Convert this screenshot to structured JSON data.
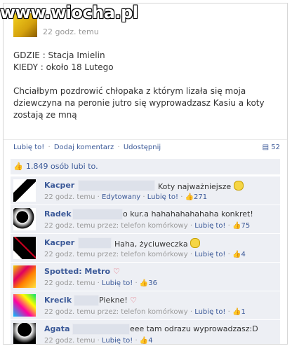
{
  "watermark": {
    "text": "www.wiocha.pl"
  },
  "post": {
    "time": "22 godz. temu",
    "lines": [
      "GDZIE : Stacja Imielin",
      "KIEDY : około 18 Lutego",
      "",
      "Chciałbym pozdrowić chłopaka z którym lizała się moja",
      "dziewczyna na peronie jutro się wyprowadzasz Kasiu a koty",
      "zostają ze mną"
    ]
  },
  "actions": {
    "like": "Lubię to!",
    "comment": "Dodaj komentarz",
    "share": "Udostępnij",
    "share_count": "52"
  },
  "likes": {
    "text": "1.849 osób lubi to."
  },
  "comments": [
    {
      "name": "Kacper",
      "text": "Koty najważniejsze",
      "emoji": "smile",
      "meta_time": "22 godz. temu",
      "meta_extra": "Edytowany",
      "meta_like": "Lubię to!",
      "likes": "271"
    },
    {
      "name": "Radek",
      "text": "o kur.a hahahahahahaha konkret!",
      "emoji": "",
      "meta_time": "22 godz. temu przez: telefon komórkowy",
      "meta_extra": "",
      "meta_like": "Lubię to!",
      "likes": "75"
    },
    {
      "name": "Kacper",
      "text": "Haha, życiuweczka",
      "emoji": "smile",
      "meta_time": "22 godz. temu przez: telefon komórkowy",
      "meta_extra": "",
      "meta_like": "Lubię to!",
      "likes": "4"
    },
    {
      "name": "Spotted: Metro",
      "text": "",
      "emoji": "heart",
      "meta_time": "22 godz. temu",
      "meta_extra": "",
      "meta_like": "Lubię to!",
      "likes": "36"
    },
    {
      "name": "Krecik",
      "text": "Piekne!",
      "emoji": "heart",
      "meta_time": "22 godz. temu przez: telefon komórkowy",
      "meta_extra": "",
      "meta_like": "Lubię to!",
      "likes": "1"
    },
    {
      "name": "Agata",
      "text": "eee tam odrazu wyprowadzasz:D",
      "emoji": "",
      "meta_time": "22 godz. temu",
      "meta_extra": "",
      "meta_like": "Lubię to!",
      "likes": "4"
    }
  ]
}
